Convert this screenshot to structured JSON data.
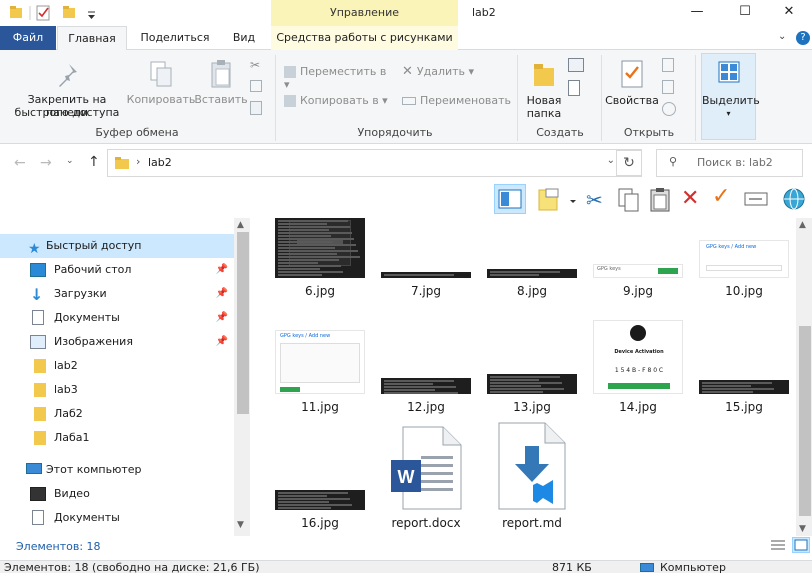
{
  "window": {
    "title": "lab2",
    "manage_label": "Управление",
    "minimize": "—",
    "maximize": "☐",
    "close": "✕"
  },
  "tabs": {
    "file": "Файл",
    "home": "Главная",
    "share": "Поделиться",
    "view": "Вид",
    "picture_tools": "Средства работы с рисунками"
  },
  "ribbon": {
    "pin": "Закрепить на панели быстрого доступа",
    "pin_line1": "Закрепить на панели",
    "pin_line2": "быстрого доступа",
    "copy": "Копировать",
    "paste": "Вставить",
    "clipboard_group": "Буфер обмена",
    "move_to": "Переместить в",
    "copy_to": "Копировать в",
    "delete": "Удалить",
    "rename": "Переименовать",
    "organize_group": "Упорядочить",
    "new_folder_line1": "Новая",
    "new_folder_line2": "папка",
    "create_group": "Создать",
    "properties": "Свойства",
    "open_group": "Открыть",
    "select": "Выделить"
  },
  "address": {
    "path": "lab2",
    "search_placeholder": "Поиск в: lab2"
  },
  "nav": {
    "quick_access": "Быстрый доступ",
    "items": [
      {
        "label": "Рабочий стол",
        "pinned": true
      },
      {
        "label": "Загрузки",
        "pinned": true
      },
      {
        "label": "Документы",
        "pinned": true
      },
      {
        "label": "Изображения",
        "pinned": true
      },
      {
        "label": "lab2",
        "pinned": false
      },
      {
        "label": "lab3",
        "pinned": false
      },
      {
        "label": "Лаб2",
        "pinned": false
      },
      {
        "label": "Лаба1",
        "pinned": false
      }
    ],
    "this_pc": "Этот компьютер",
    "pc_items": [
      {
        "label": "Видео"
      },
      {
        "label": "Документы"
      }
    ]
  },
  "files": [
    {
      "name": "6.jpg",
      "kind": "dark-dialog"
    },
    {
      "name": "7.jpg",
      "kind": "terminal"
    },
    {
      "name": "8.jpg",
      "kind": "terminal"
    },
    {
      "name": "9.jpg",
      "kind": "github-light",
      "text": "GPG keys"
    },
    {
      "name": "10.jpg",
      "kind": "github-light",
      "text": "GPG keys / Add new"
    },
    {
      "name": "11.jpg",
      "kind": "github-form",
      "text": "GPG keys / Add new"
    },
    {
      "name": "12.jpg",
      "kind": "terminal"
    },
    {
      "name": "13.jpg",
      "kind": "terminal"
    },
    {
      "name": "14.jpg",
      "kind": "device-activation",
      "text": "Device Activation",
      "code": "1 5 4 B - F 8 0 C"
    },
    {
      "name": "15.jpg",
      "kind": "terminal"
    },
    {
      "name": "16.jpg",
      "kind": "terminal"
    },
    {
      "name": "report.docx",
      "kind": "word"
    },
    {
      "name": "report.md",
      "kind": "vscode-md"
    }
  ],
  "status": {
    "items_count": "Элементов: 18",
    "bottom_line": "Элементов: 18 (свободно на диске: 21,6 ГБ)",
    "size": "871 КБ",
    "location": "Компьютер"
  },
  "colors": {
    "file_tab": "#2b579a",
    "selection": "#cce8ff",
    "manage_band": "#fbf4b8",
    "delete_red": "#d32f2f",
    "accent_orange": "#e8731a"
  }
}
